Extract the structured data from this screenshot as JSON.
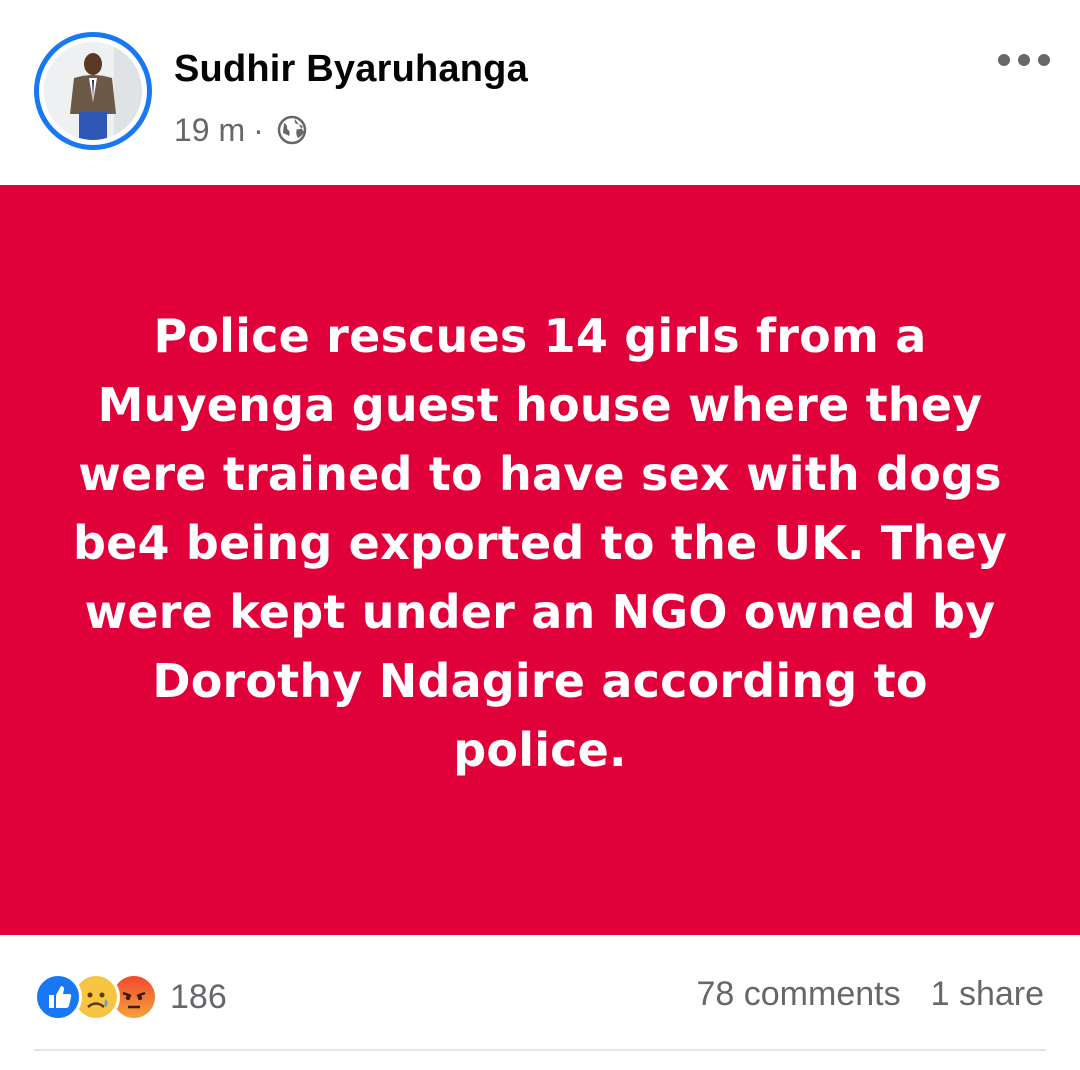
{
  "post": {
    "author": "Sudhir Byaruhanga",
    "time": "19 m",
    "separator": "·",
    "audience_icon": "globe-icon",
    "menu_icon": "more-horizontal-icon",
    "text": "Police rescues 14 girls from a Muyenga guest house where they were trained to have sex with dogs be4 being exported to the UK. They were kept under an NGO owned by Dorothy Ndagire according to police.",
    "background_color": "#e0003a",
    "text_color": "#ffffff"
  },
  "reactions": {
    "icons": [
      "like-icon",
      "sad-icon",
      "angry-icon"
    ],
    "count": "186"
  },
  "engagement": {
    "comments": "78 comments",
    "shares": "1 share"
  },
  "colors": {
    "accent": "#1877f2",
    "secondary_text": "#65676b"
  }
}
